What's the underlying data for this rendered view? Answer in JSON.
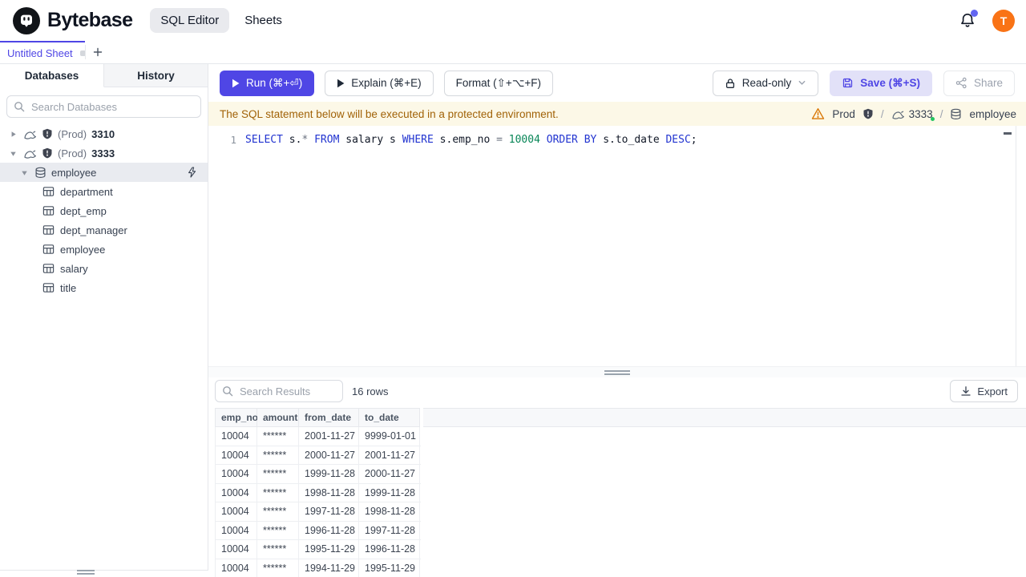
{
  "colors": {
    "accent": "#4f46e5",
    "avatar": "#f97316",
    "banner-bg": "#fcf8e7",
    "banner-text": "#a16207",
    "kw": "#2234d0",
    "num": "#098658",
    "selected-row": "#e9ebf0"
  },
  "header": {
    "brand": "Bytebase",
    "nav": [
      {
        "label": "SQL Editor"
      },
      {
        "label": "Sheets"
      }
    ],
    "avatar_initial": "T"
  },
  "sheetbar": {
    "tab_label": "Untitled Sheet"
  },
  "sidebar": {
    "tabs": [
      {
        "label": "Databases"
      },
      {
        "label": "History"
      }
    ],
    "search_placeholder": "Search Databases",
    "instances": [
      {
        "env": "(Prod)",
        "id": "3310"
      },
      {
        "env": "(Prod)",
        "id": "3333"
      }
    ],
    "database": "employee",
    "tables": [
      "department",
      "dept_emp",
      "dept_manager",
      "employee",
      "salary",
      "title"
    ]
  },
  "toolbar": {
    "run": "Run (⌘+⏎)",
    "explain": "Explain (⌘+E)",
    "format": "Format (⇧+⌥+F)",
    "readonly": "Read-only",
    "save": "Save (⌘+S)",
    "share": "Share"
  },
  "banner": {
    "message": "The SQL statement below will be executed in a protected environment.",
    "environment": "Prod",
    "slash": "/",
    "instance": "3333",
    "database": "employee"
  },
  "editor": {
    "line_number": "1",
    "sql": "SELECT s.* FROM salary s WHERE s.emp_no = 10004 ORDER BY s.to_date DESC;",
    "tokens": [
      {
        "t": "SELECT",
        "c": "kw"
      },
      {
        "t": " s.",
        "c": "pl"
      },
      {
        "t": "*",
        "c": "op"
      },
      {
        "t": " ",
        "c": "pl"
      },
      {
        "t": "FROM",
        "c": "kw"
      },
      {
        "t": " salary s ",
        "c": "pl"
      },
      {
        "t": "WHERE",
        "c": "kw"
      },
      {
        "t": " s.emp_no ",
        "c": "pl"
      },
      {
        "t": "=",
        "c": "op"
      },
      {
        "t": " ",
        "c": "pl"
      },
      {
        "t": "10004",
        "c": "num"
      },
      {
        "t": " ",
        "c": "pl"
      },
      {
        "t": "ORDER BY",
        "c": "kw"
      },
      {
        "t": " s.to_date ",
        "c": "pl"
      },
      {
        "t": "DESC",
        "c": "kw"
      },
      {
        "t": ";",
        "c": "pl"
      }
    ]
  },
  "results": {
    "search_placeholder": "Search Results",
    "row_count": "16 rows",
    "export": "Export",
    "columns": [
      "emp_no",
      "amount",
      "from_date",
      "to_date"
    ],
    "rows": [
      [
        "10004",
        "******",
        "2001-11-27",
        "9999-01-01"
      ],
      [
        "10004",
        "******",
        "2000-11-27",
        "2001-11-27"
      ],
      [
        "10004",
        "******",
        "1999-11-28",
        "2000-11-27"
      ],
      [
        "10004",
        "******",
        "1998-11-28",
        "1999-11-28"
      ],
      [
        "10004",
        "******",
        "1997-11-28",
        "1998-11-28"
      ],
      [
        "10004",
        "******",
        "1996-11-28",
        "1997-11-28"
      ],
      [
        "10004",
        "******",
        "1995-11-29",
        "1996-11-28"
      ],
      [
        "10004",
        "******",
        "1994-11-29",
        "1995-11-29"
      ]
    ]
  }
}
